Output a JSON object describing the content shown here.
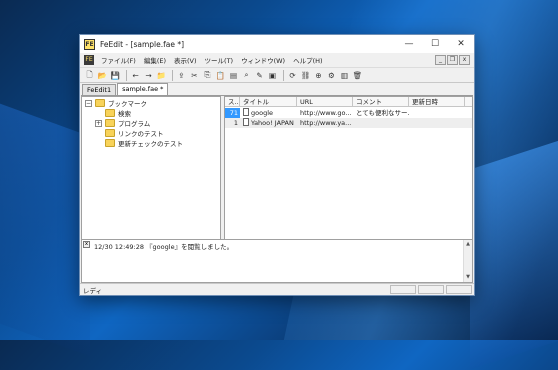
{
  "window": {
    "app_icon_label": "FE",
    "title": "FeEdit - [sample.fae *]",
    "minimize_glyph": "—",
    "maximize_glyph": "☐",
    "close_glyph": "✕"
  },
  "menubar": {
    "doc_icon_label": "FE",
    "items": [
      "ファイル(F)",
      "編集(E)",
      "表示(V)",
      "ツール(T)",
      "ウィンドウ(W)",
      "ヘルプ(H)"
    ],
    "mdi_min": "_",
    "mdi_restore": "❐",
    "mdi_close": "x"
  },
  "toolbar": {
    "groups": [
      [
        {
          "icon": "new-document-icon",
          "glyph": "🗋"
        },
        {
          "icon": "open-folder-icon",
          "glyph": "📂"
        },
        {
          "icon": "save-icon",
          "glyph": "💾"
        }
      ],
      [
        {
          "icon": "back-arrow-icon",
          "glyph": "←"
        },
        {
          "icon": "forward-arrow-icon",
          "glyph": "→"
        },
        {
          "icon": "new-folder-icon",
          "glyph": "📁"
        }
      ],
      [
        {
          "icon": "import-icon",
          "glyph": "⇪"
        },
        {
          "icon": "cut-icon",
          "glyph": "✂"
        },
        {
          "icon": "copy-icon",
          "glyph": "⎘"
        },
        {
          "icon": "paste-icon",
          "glyph": "📋"
        },
        {
          "icon": "properties-icon",
          "glyph": "▤"
        },
        {
          "icon": "find-icon",
          "glyph": "⌕"
        },
        {
          "icon": "edit-icon",
          "glyph": "✎"
        },
        {
          "icon": "image-icon",
          "glyph": "▣"
        }
      ],
      [
        {
          "icon": "check-update-icon",
          "glyph": "⟳"
        },
        {
          "icon": "link-check-icon",
          "glyph": "⛓"
        },
        {
          "icon": "browse-icon",
          "glyph": "⊕"
        },
        {
          "icon": "tools-icon",
          "glyph": "⚙"
        },
        {
          "icon": "clipboard-icon",
          "glyph": "▥"
        },
        {
          "icon": "trash-icon",
          "glyph": "🗑"
        }
      ]
    ]
  },
  "tabs": [
    {
      "label": "FeEdit1",
      "active": false
    },
    {
      "label": "sample.fae *",
      "active": true
    }
  ],
  "tree": {
    "root": {
      "expander": "−",
      "label": "ブックマーク"
    },
    "children": [
      {
        "label": "検索",
        "expander": ""
      },
      {
        "label": "プログラム",
        "expander": "+"
      },
      {
        "label": "リンクのテスト",
        "expander": ""
      },
      {
        "label": "更新チェックのテスト",
        "expander": ""
      }
    ]
  },
  "list": {
    "columns": [
      "ス...",
      "タイトル",
      "URL",
      "コメント",
      "更新日時"
    ],
    "rows": [
      {
        "num": "71",
        "title": "google",
        "url": "http://www.go...",
        "comment": "とても便利なサー...",
        "updated": "",
        "selected_num": true
      },
      {
        "num": "1",
        "title": "Yahoo! JAPAN",
        "url": "http://www.ya...",
        "comment": "",
        "updated": "",
        "selected_num": false
      }
    ]
  },
  "log": {
    "close_glyph": "x",
    "lines": [
      "12/30 12:49:28 『google』を閲覧しました。"
    ],
    "scroll_up": "▲",
    "scroll_down": "▼"
  },
  "status": {
    "text": "レディ"
  }
}
